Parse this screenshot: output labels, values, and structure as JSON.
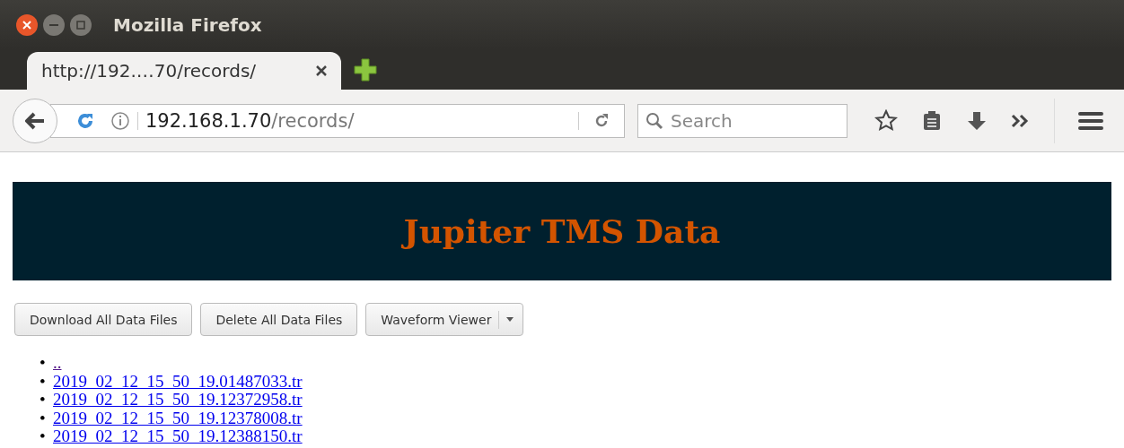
{
  "window": {
    "title": "Mozilla Firefox"
  },
  "tabs": [
    {
      "label": "http://192.…70/records/",
      "selected": true
    }
  ],
  "address": {
    "host": "192.168.1.70",
    "path": "/records/"
  },
  "search": {
    "placeholder": "Search"
  },
  "page": {
    "heading": "Jupiter TMS Data",
    "buttons": [
      {
        "label": "Download All Data Files",
        "kind": "plain"
      },
      {
        "label": "Delete All Data Files",
        "kind": "plain"
      },
      {
        "label": "Waveform Viewer",
        "kind": "split"
      }
    ],
    "links": [
      {
        "marker": "•",
        "label": "..",
        "visited": true
      },
      {
        "marker": "•",
        "label": "2019_02_12_15_50_19.01487033.tr",
        "visited": false
      },
      {
        "marker": "•",
        "label": "2019_02_12_15_50_19.12372958.tr",
        "visited": false
      },
      {
        "marker": "•",
        "label": "2019_02_12_15_50_19.12378008.tr",
        "visited": false
      },
      {
        "marker": "•",
        "label": "2019_02_12_15_50_19.12388150.tr",
        "visited": false
      }
    ]
  }
}
